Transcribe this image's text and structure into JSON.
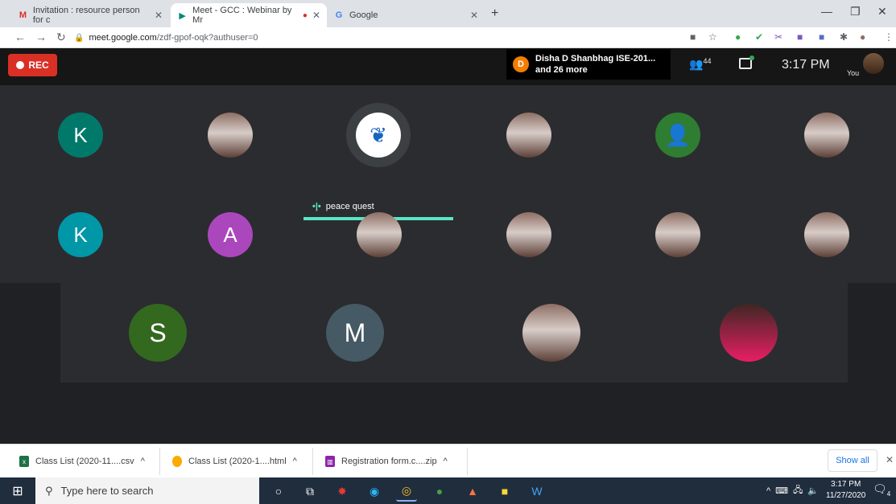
{
  "browser": {
    "tabs": [
      {
        "label": "Invitation : resource person for c",
        "icon": "gmail-icon",
        "close": "✕"
      },
      {
        "label": "Meet - GCC : Webinar by Mr",
        "icon": "meet-icon",
        "close": "✕"
      },
      {
        "label": "Google",
        "icon": "google-icon",
        "close": "✕"
      }
    ],
    "new_tab": "+",
    "url_host": "meet.google.com",
    "url_path": "/zdf-gpof-oqk?authuser=0"
  },
  "meet": {
    "rec_label": "REC",
    "notification": {
      "avatar_letter": "D",
      "line1": "Disha D Shanbhag ISE-201...",
      "line2": "and 26 more"
    },
    "participant_count": "44",
    "time": "3:17 PM",
    "self_label": "You",
    "speaker_name": "peace quest",
    "tiles_row1": [
      {
        "letter": "K",
        "color": "#00796b"
      },
      {
        "letter": "",
        "color": "photo"
      },
      {
        "letter": "",
        "color": "speaker"
      },
      {
        "letter": "",
        "color": "photo"
      },
      {
        "letter": "",
        "color": "#2e7d32"
      },
      {
        "letter": "",
        "color": "photo"
      }
    ],
    "tiles_row2": [
      {
        "letter": "K",
        "color": "#0097a7"
      },
      {
        "letter": "A",
        "color": "#ab47bc"
      },
      {
        "letter": "",
        "color": "photo"
      },
      {
        "letter": "",
        "color": "photo"
      },
      {
        "letter": "",
        "color": "photo"
      },
      {
        "letter": "",
        "color": "photo"
      }
    ],
    "tiles_row3": [
      {
        "letter": "S",
        "color": "#33691e"
      },
      {
        "letter": "M",
        "color": "#455a64"
      },
      {
        "letter": "",
        "color": "photo"
      },
      {
        "letter": "",
        "color": "photo"
      }
    ]
  },
  "downloads": {
    "items": [
      "Class List (2020-11....csv",
      "Class List (2020-1....html",
      "Registration form.c....zip"
    ],
    "show_all": "Show all",
    "close": "✕"
  },
  "taskbar": {
    "search_placeholder": "Type here to search",
    "time": "3:17 PM",
    "date": "11/27/2020",
    "notif_count": "4"
  }
}
